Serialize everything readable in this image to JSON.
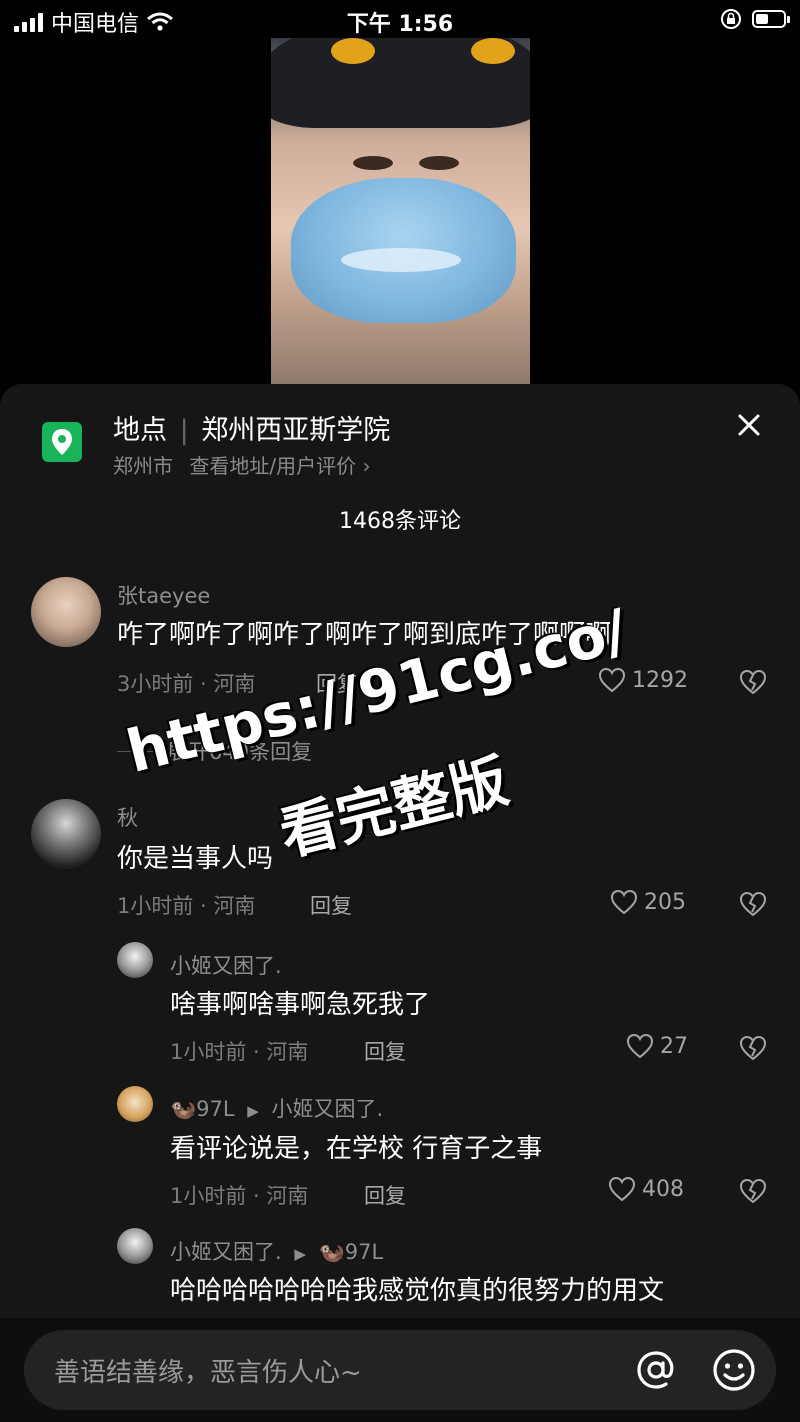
{
  "status_bar": {
    "carrier": "中国电信",
    "time": "下午 1:56"
  },
  "location": {
    "label": "地点",
    "name": "郑州西亚斯学院",
    "city": "郑州市",
    "detail_link": "查看地址/用户评价 ›"
  },
  "comments_header": {
    "count_label": "1468条评论"
  },
  "comments": [
    {
      "username": "张taeyee",
      "text": "咋了啊咋了啊咋了啊咋了啊到底咋了啊啊啊",
      "meta": "3小时前 · 河南",
      "reply_label": "回复",
      "likes": "1292"
    },
    {
      "username": "秋",
      "text": "你是当事人吗",
      "meta": "1小时前 · 河南",
      "reply_label": "回复",
      "likes": "205"
    }
  ],
  "expand": {
    "label": "展开649条回复"
  },
  "replies": [
    {
      "username": "小姬又困了.",
      "text": "啥事啊啥事啊急死我了",
      "meta": "1小时前 · 河南",
      "reply_label": "回复",
      "likes": "27"
    },
    {
      "username": "🦦97L",
      "reply_to": "小姬又困了.",
      "text": "看评论说是，在学校 行育子之事",
      "meta": "1小时前 · 河南",
      "reply_label": "回复",
      "likes": "408"
    },
    {
      "username": "小姬又困了.",
      "reply_to": "🦦97L",
      "text": "哈哈哈哈哈哈哈我感觉你真的很努力的用文"
    }
  ],
  "watermark": {
    "line1": "https://91cg.co/",
    "line2": "看完整版"
  },
  "input_bar": {
    "placeholder": "善语结善缘，恶言伤人心~"
  },
  "icons": {
    "location": "map-pin-icon",
    "close": "close-icon",
    "like": "heart-outline-icon",
    "dislike": "broken-heart-icon",
    "at": "at-sign-icon",
    "emoji": "smiley-icon"
  },
  "colors": {
    "sheet_background": "#161616",
    "location_icon": "#19b35a",
    "muted_text": "#8d8d8d"
  }
}
